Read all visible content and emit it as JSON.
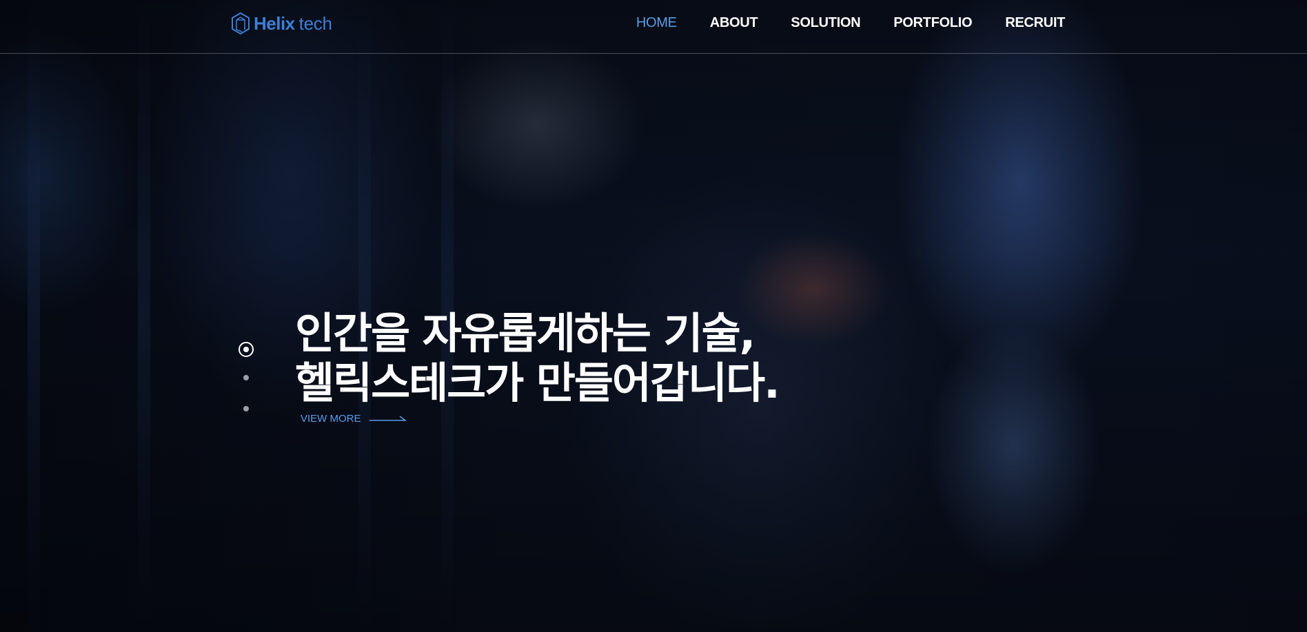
{
  "brand": {
    "name_bold": "Helix",
    "name_light": "tech",
    "logo_icon": "hex-cube-icon",
    "accent_color": "#3c7fd6"
  },
  "nav": {
    "items": [
      {
        "label": "HOME",
        "active": true
      },
      {
        "label": "ABOUT",
        "active": false
      },
      {
        "label": "SOLUTION",
        "active": false
      },
      {
        "label": "PORTFOLIO",
        "active": false
      },
      {
        "label": "RECRUIT",
        "active": false
      }
    ],
    "active_color": "#5a9de8"
  },
  "hero": {
    "headline_line1": "인간을 자유롭게하는 기술,",
    "headline_line2": "헬릭스테크가 만들어갑니다.",
    "cta_label": "VIEW MORE",
    "cta_icon": "arrow-right-icon",
    "slides_total": 3,
    "slide_active": 1
  }
}
